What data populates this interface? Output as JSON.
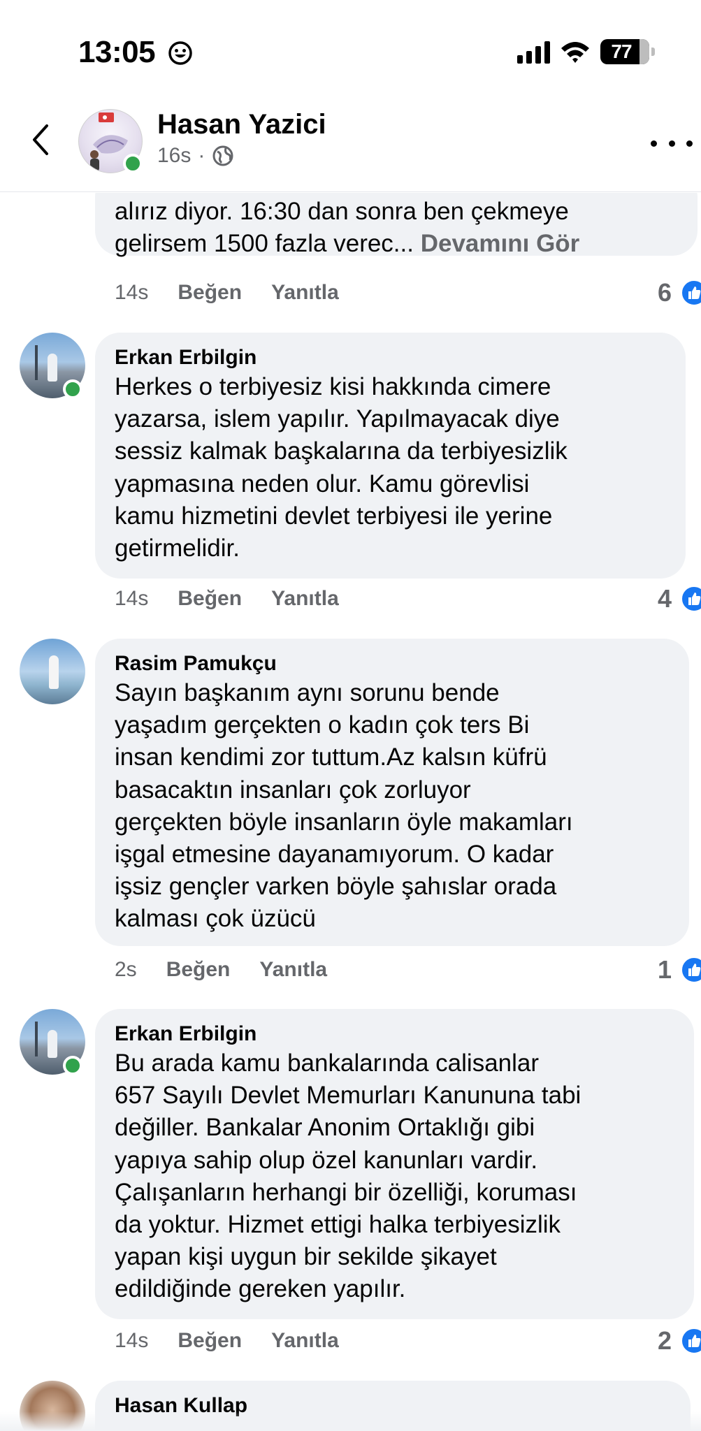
{
  "status_bar": {
    "time": "13:05",
    "battery": "77"
  },
  "header": {
    "author_name": "Hasan Yazici",
    "post_age": "16s",
    "separator": "·"
  },
  "partial_comment": {
    "text": "alırız diyor. 16:30 dan sonra ben çekmeye\ngelirsem 1500 fazla verec...",
    "see_more": "Devamını Gör",
    "time": "14s",
    "like_label": "Beğen",
    "reply_label": "Yanıtla",
    "reaction_count": "6"
  },
  "comments": [
    {
      "name": "Erkan Erbilgin",
      "text": "Herkes o terbiyesiz kisi hakkında cimere\nyazarsa, islem yapılır. Yapılmayacak diye\nsessiz kalmak başkalarına da terbiyesizlik\nyapmasına neden olur. Kamu görevlisi\nkamu hizmetini devlet terbiyesi ile yerine\ngetirmelidir.",
      "time": "14s",
      "like_label": "Beğen",
      "reply_label": "Yanıtla",
      "reaction_count": "4"
    },
    {
      "name": "Rasim Pamukçu",
      "text": "Sayın başkanım aynı sorunu bende\nyaşadım gerçekten o kadın  çok ters Bi\ninsan kendimi zor tuttum.Az kalsın küfrü\nbasacaktın insanları çok zorluyor\ngerçekten böyle insanların öyle makamları\nişgal etmesine dayanamıyorum. O kadar\nişsiz gençler varken böyle şahıslar orada\nkalması çok üzücü",
      "time": "2s",
      "like_label": "Beğen",
      "reply_label": "Yanıtla",
      "reaction_count": "1"
    },
    {
      "name": "Erkan Erbilgin",
      "text": "Bu arada kamu bankalarında calisanlar\n657 Sayılı Devlet Memurları Kanununa tabi\ndeğiller.  Bankalar Anonim Ortaklığı gibi\nyapıya sahip olup özel kanunları vardir.\nÇalışanların herhangi bir özelliği, koruması\nda yoktur. Hizmet ettigi halka terbiyesizlik\nyapan kişi uygun bir sekilde şikayet\nedildiğinde gereken yapılır.",
      "time": "14s",
      "like_label": "Beğen",
      "reply_label": "Yanıtla",
      "reaction_count": "2"
    },
    {
      "name": "Hasan Kullap"
    }
  ],
  "colors": {
    "online": "#31a24c",
    "like_blue": "#1877f2",
    "bubble_bg": "#f0f2f5",
    "muted_text": "#65676b"
  },
  "icons": {
    "back": "chevron-left-icon",
    "globe": "globe-icon",
    "more": "more-horizontal-icon",
    "like": "thumbs-up-icon",
    "emoji": "smiley-icon",
    "signal": "cellular-signal-icon",
    "wifi": "wifi-icon",
    "battery": "battery-icon"
  }
}
